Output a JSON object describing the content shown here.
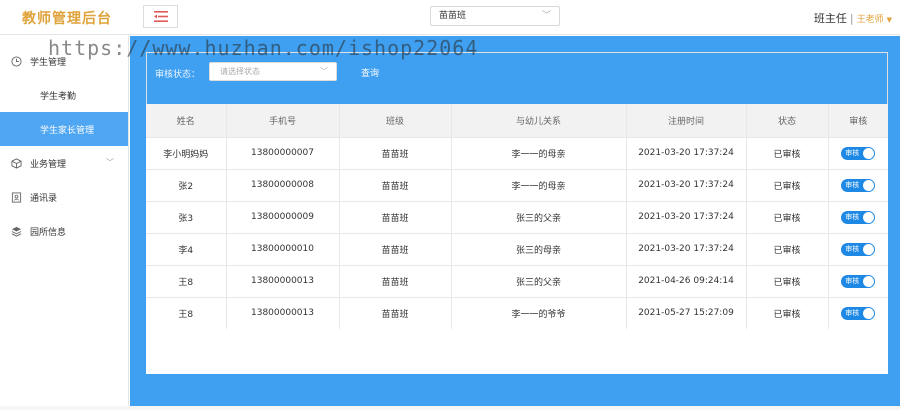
{
  "header": {
    "logo": "教师管理后台",
    "class_select": "苗苗班",
    "role": "班主任",
    "separator": "|",
    "user": "王老师"
  },
  "sidebar": {
    "items": [
      {
        "label": "学生管理",
        "icon": "clock-icon"
      },
      {
        "label": "学生考勤"
      },
      {
        "label": "学生家长管理"
      },
      {
        "label": "业务管理",
        "icon": "cube-icon"
      },
      {
        "label": "通讯录",
        "icon": "contact-card-icon"
      },
      {
        "label": "园所信息",
        "icon": "layers-icon"
      }
    ]
  },
  "filter": {
    "label": "审核状态：",
    "placeholder": "请选择状态",
    "query_button": "查询"
  },
  "table": {
    "columns": [
      "姓名",
      "手机号",
      "班级",
      "与幼儿关系",
      "注册时间",
      "状态",
      "审核"
    ],
    "rows": [
      {
        "name": "李小明妈妈",
        "phone": "13800000007",
        "class": "苗苗班",
        "relation": "李一一的母亲",
        "time": "2021-03-20 17:37:24",
        "status": "已审核",
        "review": "审核"
      },
      {
        "name": "张2",
        "phone": "13800000008",
        "class": "苗苗班",
        "relation": "李一一的母亲",
        "time": "2021-03-20 17:37:24",
        "status": "已审核",
        "review": "审核"
      },
      {
        "name": "张3",
        "phone": "13800000009",
        "class": "苗苗班",
        "relation": "张三的父亲",
        "time": "2021-03-20 17:37:24",
        "status": "已审核",
        "review": "审核"
      },
      {
        "name": "李4",
        "phone": "13800000010",
        "class": "苗苗班",
        "relation": "张三的母亲",
        "time": "2021-03-20 17:37:24",
        "status": "已审核",
        "review": "审核"
      },
      {
        "name": "王8",
        "phone": "13800000013",
        "class": "苗苗班",
        "relation": "张三的父亲",
        "time": "2021-04-26 09:24:14",
        "status": "已审核",
        "review": "审核"
      },
      {
        "name": "王8",
        "phone": "13800000013",
        "class": "苗苗班",
        "relation": "李一一的爷爷",
        "time": "2021-05-27 15:27:09",
        "status": "已审核",
        "review": "审核"
      }
    ]
  },
  "watermark": "https://www.huzhan.com/ishop22064",
  "colors": {
    "accent": "#3f9ff0",
    "active_nav": "#4fa6f2",
    "logo": "#e0a23a",
    "toggle": "#1e88e5"
  }
}
